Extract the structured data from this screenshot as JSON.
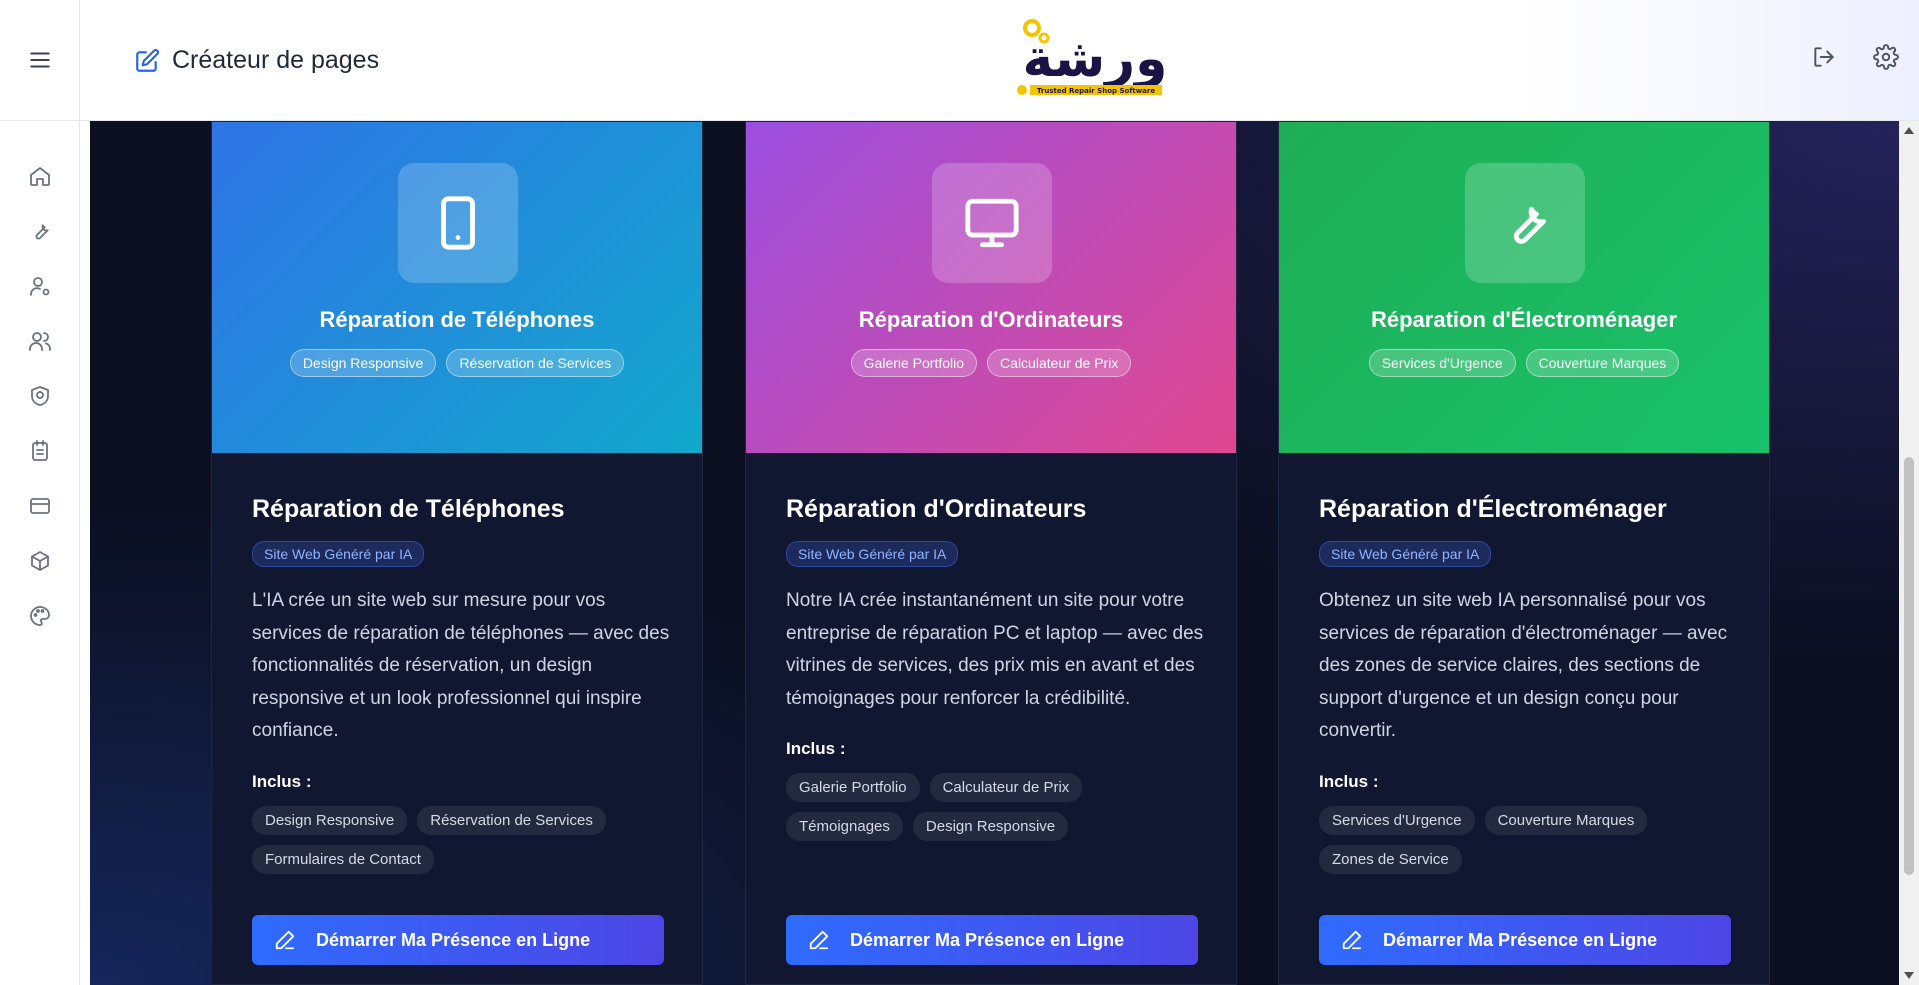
{
  "header": {
    "title": "Créateur de pages",
    "logo_text": "ورشة",
    "logo_tagline": "Trusted Repair Shop Software"
  },
  "sidebar": {
    "icons": [
      "home-icon",
      "wrench-icon",
      "user-gear-icon",
      "users-icon",
      "shield-icon",
      "clipboard-icon",
      "credit-card-icon",
      "box-icon",
      "palette-icon"
    ]
  },
  "cards": [
    {
      "banner_title": "Réparation de Téléphones",
      "banner_tags": [
        "Design Responsive",
        "Réservation de Services"
      ],
      "title": "Réparation de Téléphones",
      "badge": "Site Web Généré par IA",
      "description": "L'IA crée un site web sur mesure pour vos services de réparation de téléphones — avec des fonctionnalités de réservation, un design responsive et un look professionnel qui inspire confiance.",
      "included_label": "Inclus :",
      "features": [
        "Design Responsive",
        "Réservation de Services",
        "Formulaires de Contact"
      ],
      "cta": "Démarrer Ma Présence en Ligne",
      "icon": "smartphone-icon",
      "gradient": [
        "#2f74e6",
        "#12a8cc"
      ]
    },
    {
      "banner_title": "Réparation d'Ordinateurs",
      "banner_tags": [
        "Galerie Portfolio",
        "Calculateur de Prix"
      ],
      "title": "Réparation d'Ordinateurs",
      "badge": "Site Web Généré par IA",
      "description": "Notre IA crée instantanément un site pour votre entreprise de réparation PC et laptop — avec des vitrines de services, des prix mis en avant et des témoignages pour renforcer la crédibilité.",
      "included_label": "Inclus :",
      "features": [
        "Galerie Portfolio",
        "Calculateur de Prix",
        "Témoignages",
        "Design Responsive"
      ],
      "cta": "Démarrer Ma Présence en Ligne",
      "icon": "monitor-icon",
      "gradient": [
        "#9b4fe0",
        "#e0488f"
      ]
    },
    {
      "banner_title": "Réparation d'Électroménager",
      "banner_tags": [
        "Services d'Urgence",
        "Couverture Marques"
      ],
      "title": "Réparation d'Électroménager",
      "badge": "Site Web Généré par IA",
      "description": "Obtenez un site web IA personnalisé pour vos services de réparation d'électroménager — avec des zones de service claires, des sections de support d'urgence et un design conçu pour convertir.",
      "included_label": "Inclus :",
      "features": [
        "Services d'Urgence",
        "Couverture Marques",
        "Zones de Service"
      ],
      "cta": "Démarrer Ma Présence en Ligne",
      "icon": "wrench-icon",
      "gradient": [
        "#1fae55",
        "#18c16a"
      ]
    }
  ]
}
